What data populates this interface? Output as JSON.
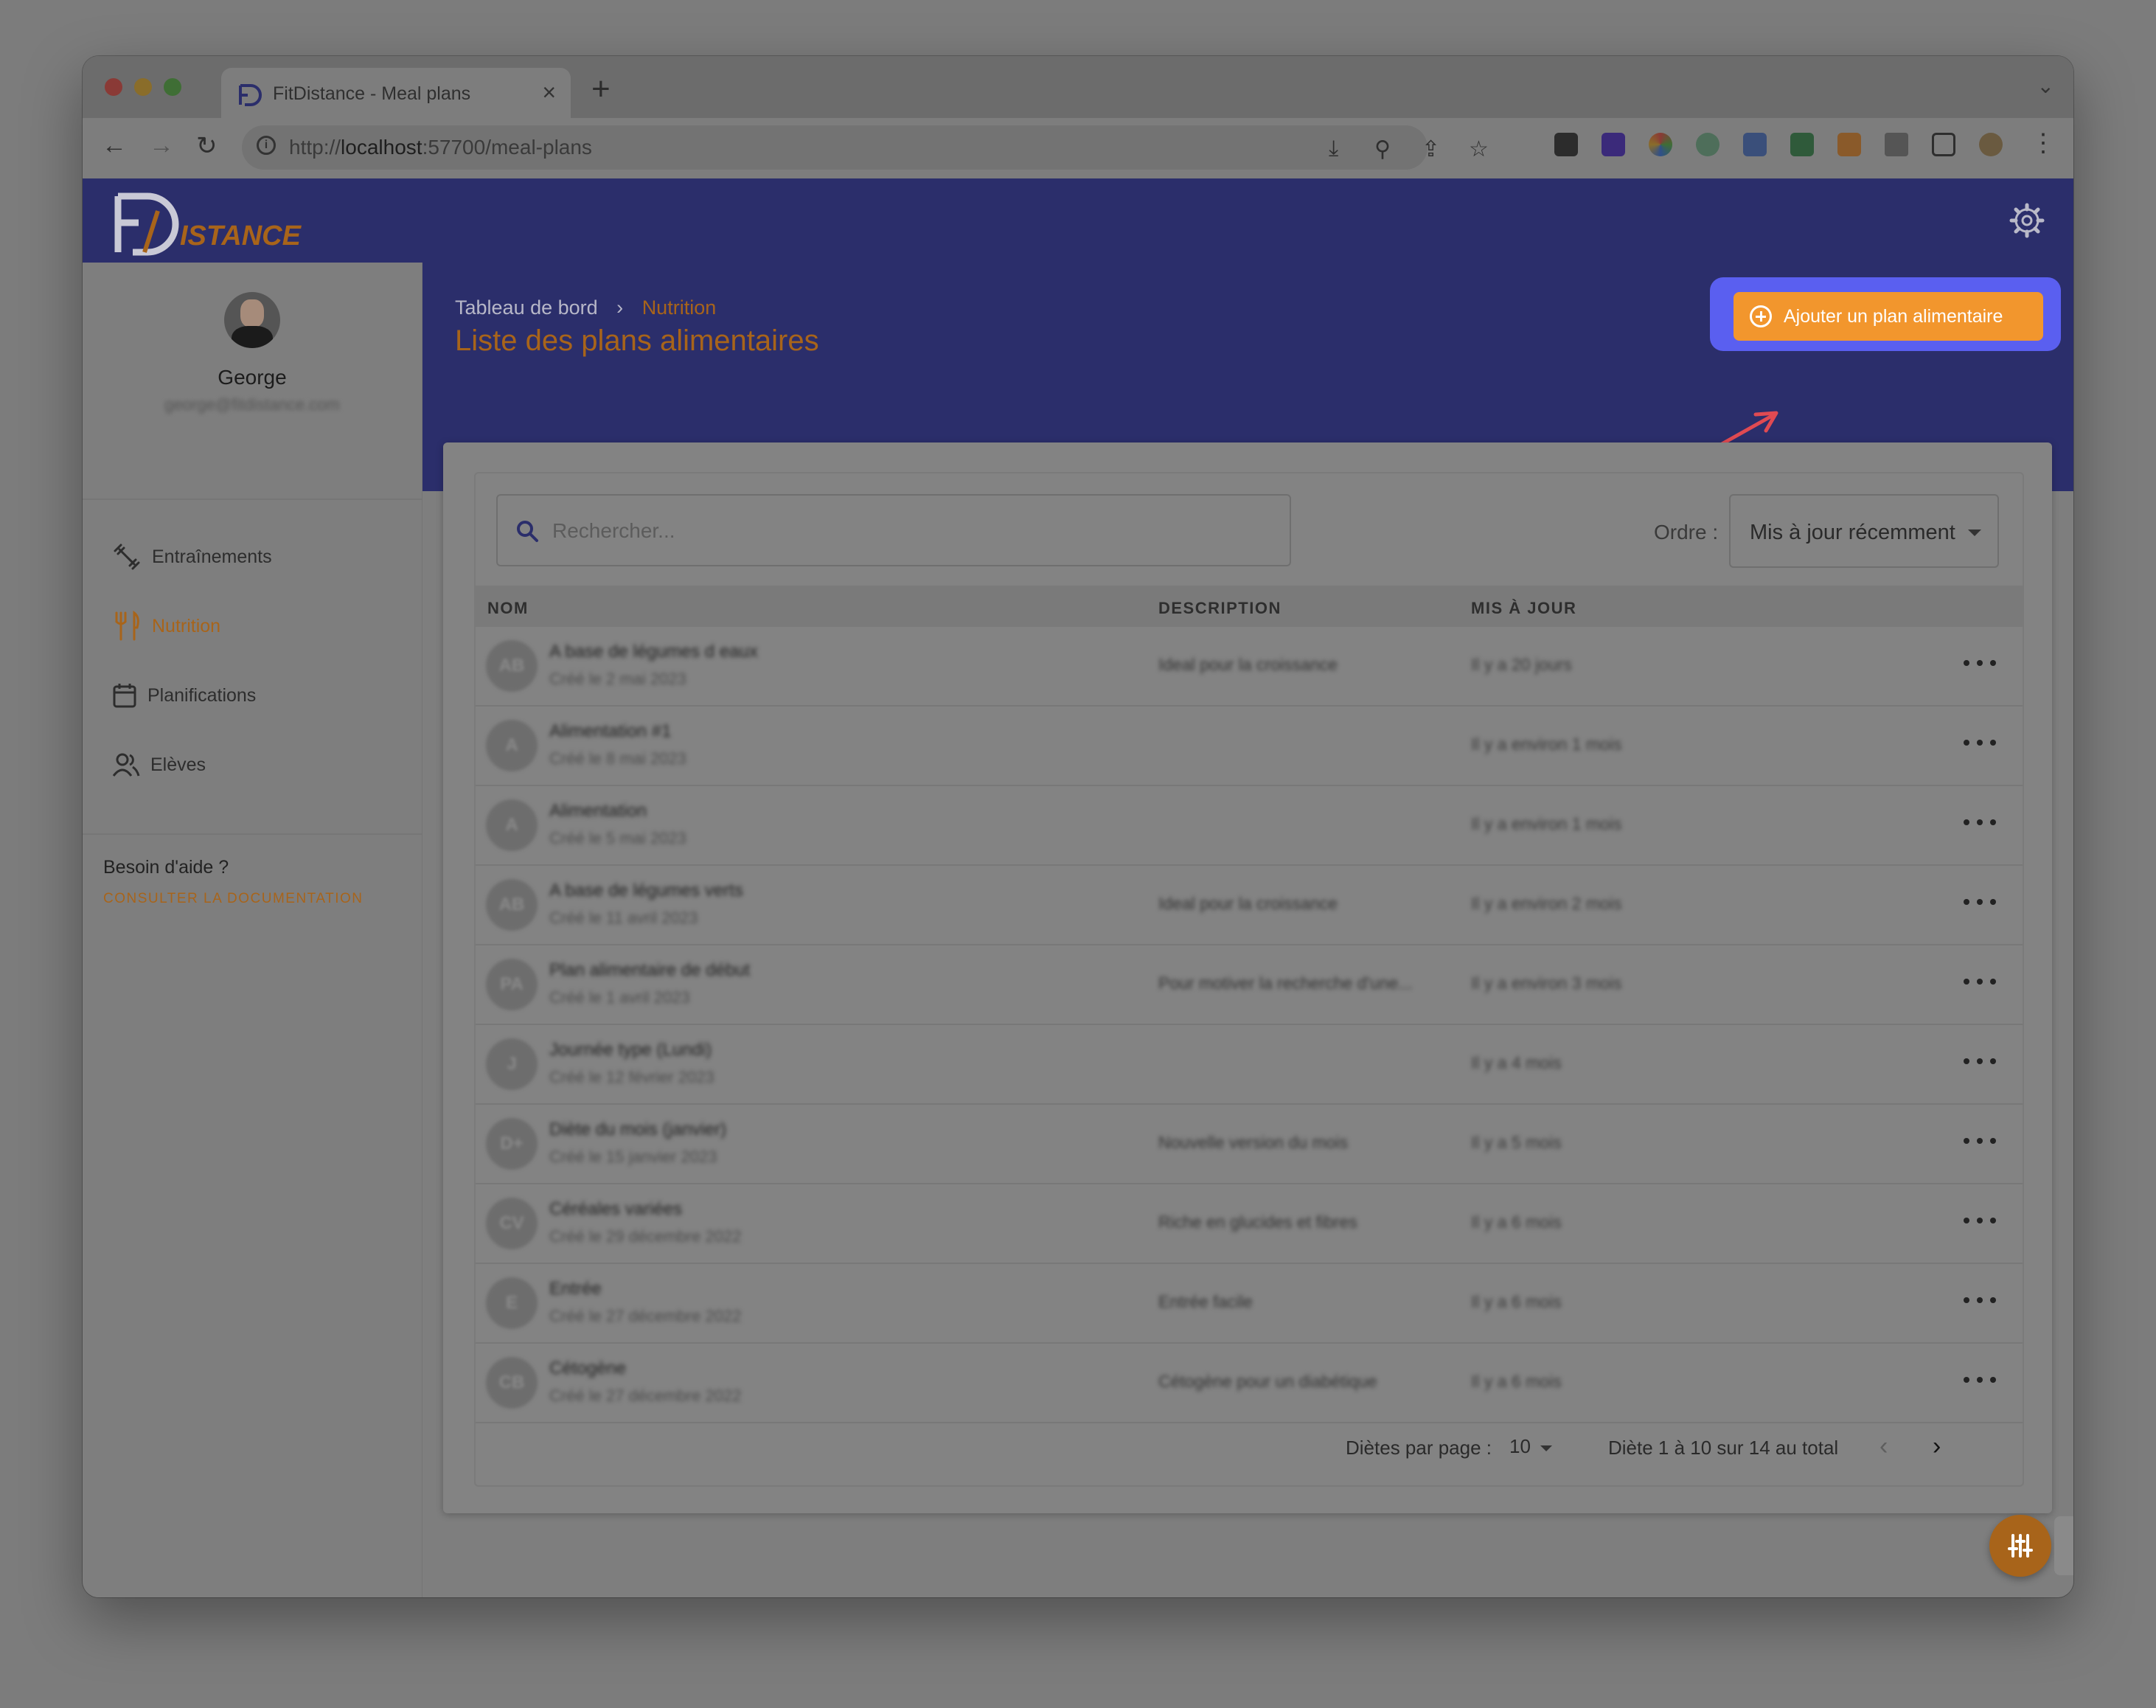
{
  "browser": {
    "tab_title": "FitDistance - Meal plans",
    "url_prefix": "http://",
    "url_host": "localhost",
    "url_path": ":57700/meal-plans"
  },
  "app": {
    "logo_text": "ISTANCE",
    "logo_letters": "FD"
  },
  "sidebar": {
    "user_name": "George",
    "user_email": "george@fitdistance.com",
    "items": [
      {
        "label": "Entraînements",
        "icon": "dumbbell-icon"
      },
      {
        "label": "Nutrition",
        "icon": "utensils-icon",
        "active": true
      },
      {
        "label": "Planifications",
        "icon": "calendar-icon"
      },
      {
        "label": "Elèves",
        "icon": "users-icon"
      }
    ],
    "help_title": "Besoin d'aide ?",
    "help_link": "CONSULTER LA DOCUMENTATION"
  },
  "main": {
    "breadcrumb_root": "Tableau de bord",
    "breadcrumb_sep": "›",
    "breadcrumb_current": "Nutrition",
    "title": "Liste des plans alimentaires",
    "add_button": "Ajouter un plan alimentaire",
    "search_placeholder": "Rechercher...",
    "order_label": "Ordre :",
    "order_value": "Mis à jour récemment",
    "columns": {
      "name": "NOM",
      "description": "DESCRIPTION",
      "updated": "MIS À JOUR"
    },
    "rows": [
      {
        "initials": "AB",
        "name": "A base de légumes d eaux",
        "created": "Créé le 2 mai 2023",
        "description": "Ideal pour la croissance",
        "updated": "Il y a 20 jours"
      },
      {
        "initials": "A",
        "name": "Alimentation #1",
        "created": "Créé le 8 mai 2023",
        "description": "",
        "updated": "Il y a environ 1 mois"
      },
      {
        "initials": "A",
        "name": "Alimentation",
        "created": "Créé le 5 mai 2023",
        "description": "",
        "updated": "Il y a environ 1 mois"
      },
      {
        "initials": "AB",
        "name": "A base de légumes verts",
        "created": "Créé le 11 avril 2023",
        "description": "Ideal pour la croissance",
        "updated": "Il y a environ 2 mois"
      },
      {
        "initials": "PA",
        "name": "Plan alimentaire de début",
        "created": "Créé le 1 avril 2023",
        "description": "Pour motiver la recherche d'une...",
        "updated": "Il y a environ 3 mois"
      },
      {
        "initials": "J",
        "name": "Journée type (Lundi)",
        "created": "Créé le 12 février 2023",
        "description": "",
        "updated": "Il y a 4 mois"
      },
      {
        "initials": "D+",
        "name": "Diète du mois (janvier)",
        "created": "Créé le 15 janvier 2023",
        "description": "Nouvelle version du mois",
        "updated": "Il y a 5 mois"
      },
      {
        "initials": "CV",
        "name": "Céréales variées",
        "created": "Créé le 29 décembre 2022",
        "description": "Riche en glucides et fibres",
        "updated": "Il y a 6 mois"
      },
      {
        "initials": "E",
        "name": "Entrée",
        "created": "Créé le 27 décembre 2022",
        "description": "Entrée facile",
        "updated": "Il y a 6 mois"
      },
      {
        "initials": "CB",
        "name": "Cétogène",
        "created": "Créé le 27 décembre 2022",
        "description": "Cétogène pour un diabétique",
        "updated": "Il y a 6 mois"
      }
    ],
    "pagination": {
      "per_page_label": "Diètes par page :",
      "per_page_value": "10",
      "range": "Diète 1 à 10 sur 14 au total"
    }
  },
  "colors": {
    "brand_navy": "#2b2e6b",
    "accent_orange": "#f2962d",
    "highlight_blue": "#5a5ff0"
  }
}
